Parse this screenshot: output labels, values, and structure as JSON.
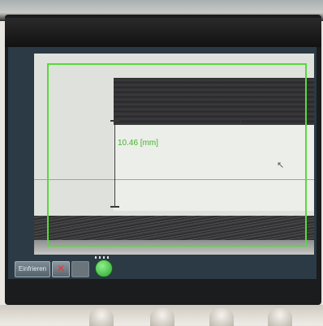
{
  "measurement": {
    "label": "10.46 [mm]"
  },
  "toolbar": {
    "abort_label": "Einfrieren",
    "delete_icon": "cross-icon",
    "ok_icon": "green-circle-icon"
  },
  "colors": {
    "overlay": "#57d93a",
    "screen_background": "#2b3a44"
  }
}
